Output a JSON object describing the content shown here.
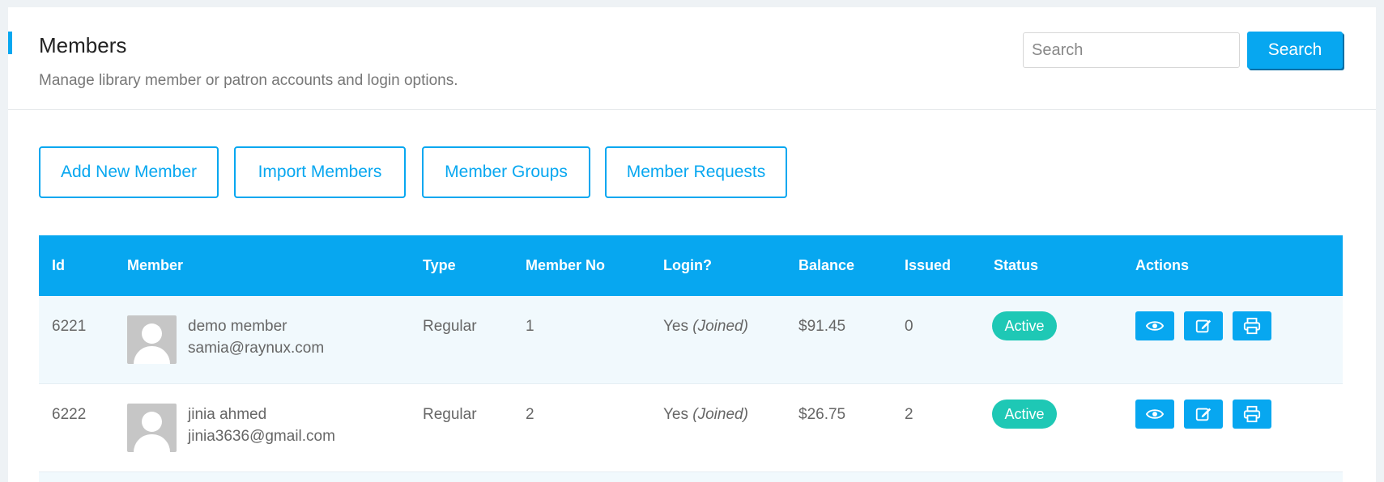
{
  "header": {
    "title": "Members",
    "subtitle": "Manage library member or patron accounts and login options.",
    "search_placeholder": "Search",
    "search_button": "Search"
  },
  "actions": [
    {
      "label": "Add New Member"
    },
    {
      "label": "Import Members"
    },
    {
      "label": "Member Groups"
    },
    {
      "label": "Member Requests"
    }
  ],
  "table": {
    "columns": [
      "Id",
      "Member",
      "Type",
      "Member No",
      "Login?",
      "Balance",
      "Issued",
      "Status",
      "Actions"
    ],
    "rows": [
      {
        "id": "6221",
        "name": "demo member",
        "email": "samia@raynux.com",
        "type": "Regular",
        "member_no": "1",
        "login": "Yes",
        "login_note": "(Joined)",
        "balance": "$91.45",
        "issued": "0",
        "status": "Active"
      },
      {
        "id": "6222",
        "name": "jinia ahmed",
        "email": "jinia3636@gmail.com",
        "type": "Regular",
        "member_no": "2",
        "login": "Yes",
        "login_note": "(Joined)",
        "balance": "$26.75",
        "issued": "2",
        "status": "Active"
      }
    ],
    "row_action_icons": [
      "eye-icon",
      "edit-icon",
      "print-icon"
    ]
  },
  "colors": {
    "accent": "#07a7f0",
    "status_active": "#1ec8b5",
    "row_alt": "#f1f9fd"
  }
}
